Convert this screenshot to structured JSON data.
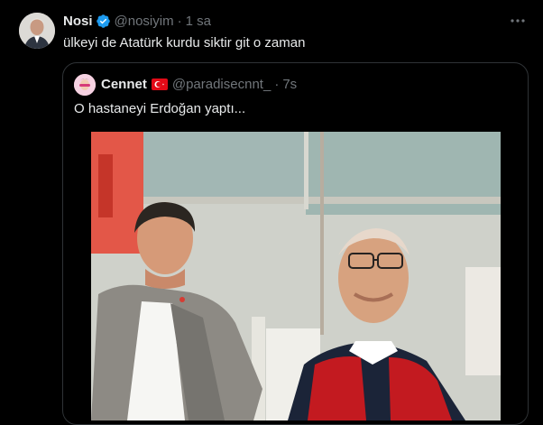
{
  "tweet": {
    "author_name": "Nosi",
    "author_handle": "@nosiyim",
    "separator": "·",
    "time": "1 sa",
    "text": "ülkeyi de Atatürk kurdu siktir git o zaman"
  },
  "quote": {
    "author_name": "Cennet",
    "author_handle": "@paradisecnnt_",
    "separator": "·",
    "time": "7s",
    "text": "O hastaneyi Erdoğan yaptı..."
  },
  "icons": {
    "verified": "verified-badge-icon",
    "more": "more-options-icon",
    "flag": "turkey-flag-icon"
  },
  "colors": {
    "background": "#000000",
    "text": "#e7e9ea",
    "muted": "#71767b",
    "verified": "#1d9bf0",
    "border": "#2f3336"
  }
}
